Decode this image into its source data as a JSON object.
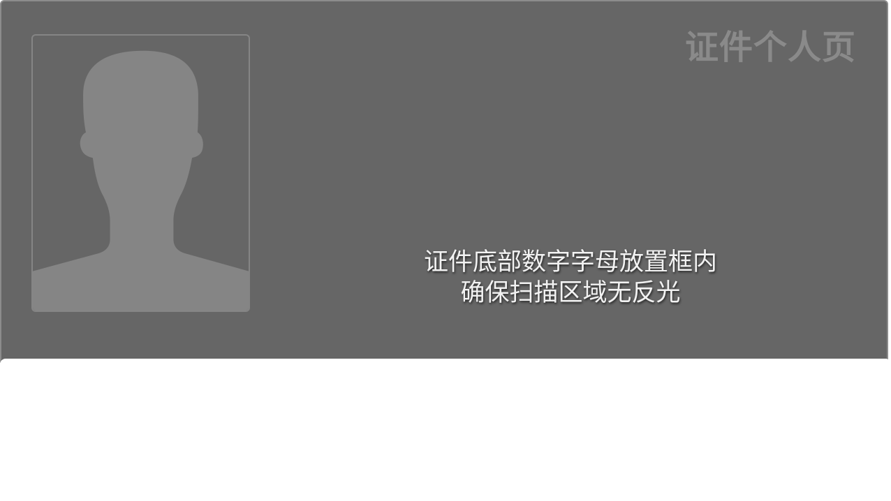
{
  "card": {
    "page_label": "证件个人页",
    "portrait_icon": "person-silhouette-icon",
    "instructions": {
      "line1": "证件底部数字字母放置框内",
      "line2": "确保扫描区域无反光"
    }
  },
  "colors": {
    "frame_background": "#666666",
    "frame_border": "#8c8c8c",
    "silhouette": "#858585",
    "label": "#8a8a8a",
    "instruction_text": "#f2f2f2",
    "panel": "#ffffff"
  }
}
